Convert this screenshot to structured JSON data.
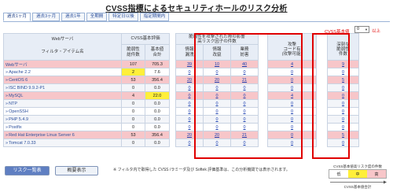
{
  "page": {
    "title": "CVSS指標によるセキュリティホールのリスク分析"
  },
  "tabs": [
    {
      "label": "過去1ヶ月"
    },
    {
      "label": "過去3ヶ月"
    },
    {
      "label": "過去1年"
    },
    {
      "label": "全期間"
    },
    {
      "label": "特定日以後"
    },
    {
      "label": "指定期間内"
    }
  ],
  "base": {
    "label": "CVSS基本値",
    "value": "0",
    "unit": "以上"
  },
  "table": {
    "headers": {
      "webserver": "Webサーバ",
      "filter": "フィルタ・アイテム名",
      "cvss_group": "CVSS基本評価",
      "cvss_vuln": "脆弱性\n総件数",
      "cvss_total": "基本値\n合計",
      "impact_group": "脆弱性を攻撃された際の影響\n高リスク因子の件数",
      "info_leak": "情報\n漏洩",
      "info_tamper": "情報\n改竄",
      "service_dos": "業務\n妨害",
      "attack_code": "攻撃\nコード有\n(攻撃可能)",
      "deep_vuln": "深刻な\n脆弱性\n件数"
    },
    "rows": [
      {
        "name": "Webサーバ",
        "prefix": "",
        "vuln": "107",
        "score": "705.3",
        "leak": "39",
        "tamper": "10",
        "dos": "40",
        "attack": "4",
        "deep": "9",
        "style": "hl"
      },
      {
        "name": "Apache 2.2",
        "prefix": "»",
        "vuln": "2",
        "score": "7.6",
        "leak": "0",
        "tamper": "0",
        "dos": "0",
        "attack": "0",
        "deep": "0",
        "style": "plain",
        "vuln_yellow": true
      },
      {
        "name": "CentOS 6",
        "prefix": "»",
        "vuln": "53",
        "score": "356.4",
        "leak": "20",
        "tamper": "20",
        "dos": "21",
        "attack": "0",
        "deep": "5",
        "style": "hl"
      },
      {
        "name": "ISC BIND 9.9.2-P1",
        "prefix": "»",
        "vuln": "0",
        "score": "0.0",
        "leak": "0",
        "tamper": "0",
        "dos": "0",
        "attack": "0",
        "deep": "0",
        "style": "alt"
      },
      {
        "name": "MySQL",
        "prefix": "»",
        "vuln": "4",
        "score": "22.0",
        "leak": "0",
        "tamper": "0",
        "dos": "0",
        "attack": "4",
        "deep": "0",
        "style": "hl",
        "score_yellow": true
      },
      {
        "name": "NTP",
        "prefix": "»",
        "vuln": "0",
        "score": "0.0",
        "leak": "0",
        "tamper": "0",
        "dos": "0",
        "attack": "0",
        "deep": "0",
        "style": "alt"
      },
      {
        "name": "OpenSSH",
        "prefix": "»",
        "vuln": "0",
        "score": "0.0",
        "leak": "0",
        "tamper": "0",
        "dos": "0",
        "attack": "0",
        "deep": "0",
        "style": "plain"
      },
      {
        "name": "PHP 5.4.9",
        "prefix": "»",
        "vuln": "0",
        "score": "0.0",
        "leak": "0",
        "tamper": "0",
        "dos": "0",
        "attack": "0",
        "deep": "0",
        "style": "alt"
      },
      {
        "name": "Postfix",
        "prefix": "»",
        "vuln": "0",
        "score": "0.0",
        "leak": "0",
        "tamper": "0",
        "dos": "0",
        "attack": "0",
        "deep": "0",
        "style": "plain"
      },
      {
        "name": "Red Hat Enterprise Linux Server 6",
        "prefix": "»",
        "vuln": "53",
        "score": "356.4",
        "leak": "20",
        "tamper": "20",
        "dos": "21",
        "attack": "0",
        "deep": "5",
        "style": "hl"
      },
      {
        "name": "Tomcat 7.0.33",
        "prefix": "»",
        "vuln": "0",
        "score": "0.0",
        "leak": "0",
        "tamper": "0",
        "dos": "0",
        "attack": "0",
        "deep": "0",
        "style": "alt"
      }
    ]
  },
  "buttons": {
    "risk_list": "リスク一覧表",
    "overview": "概要表示"
  },
  "footnote": "※ フィルタ内で取得した CVSS /ラミーダ及び Softek 評価基準は、この分析機関では表示されます。",
  "legend": {
    "caption": "CVSS基本値高リスク度の件数",
    "labels": [
      "低",
      "中",
      "高"
    ],
    "caption2": "CVSS基本値合計"
  },
  "colors": {
    "highlight": "#f7c6c9",
    "yellow": "#ffef3a",
    "redbox": "#e00000",
    "link": "#1b3fb0"
  }
}
